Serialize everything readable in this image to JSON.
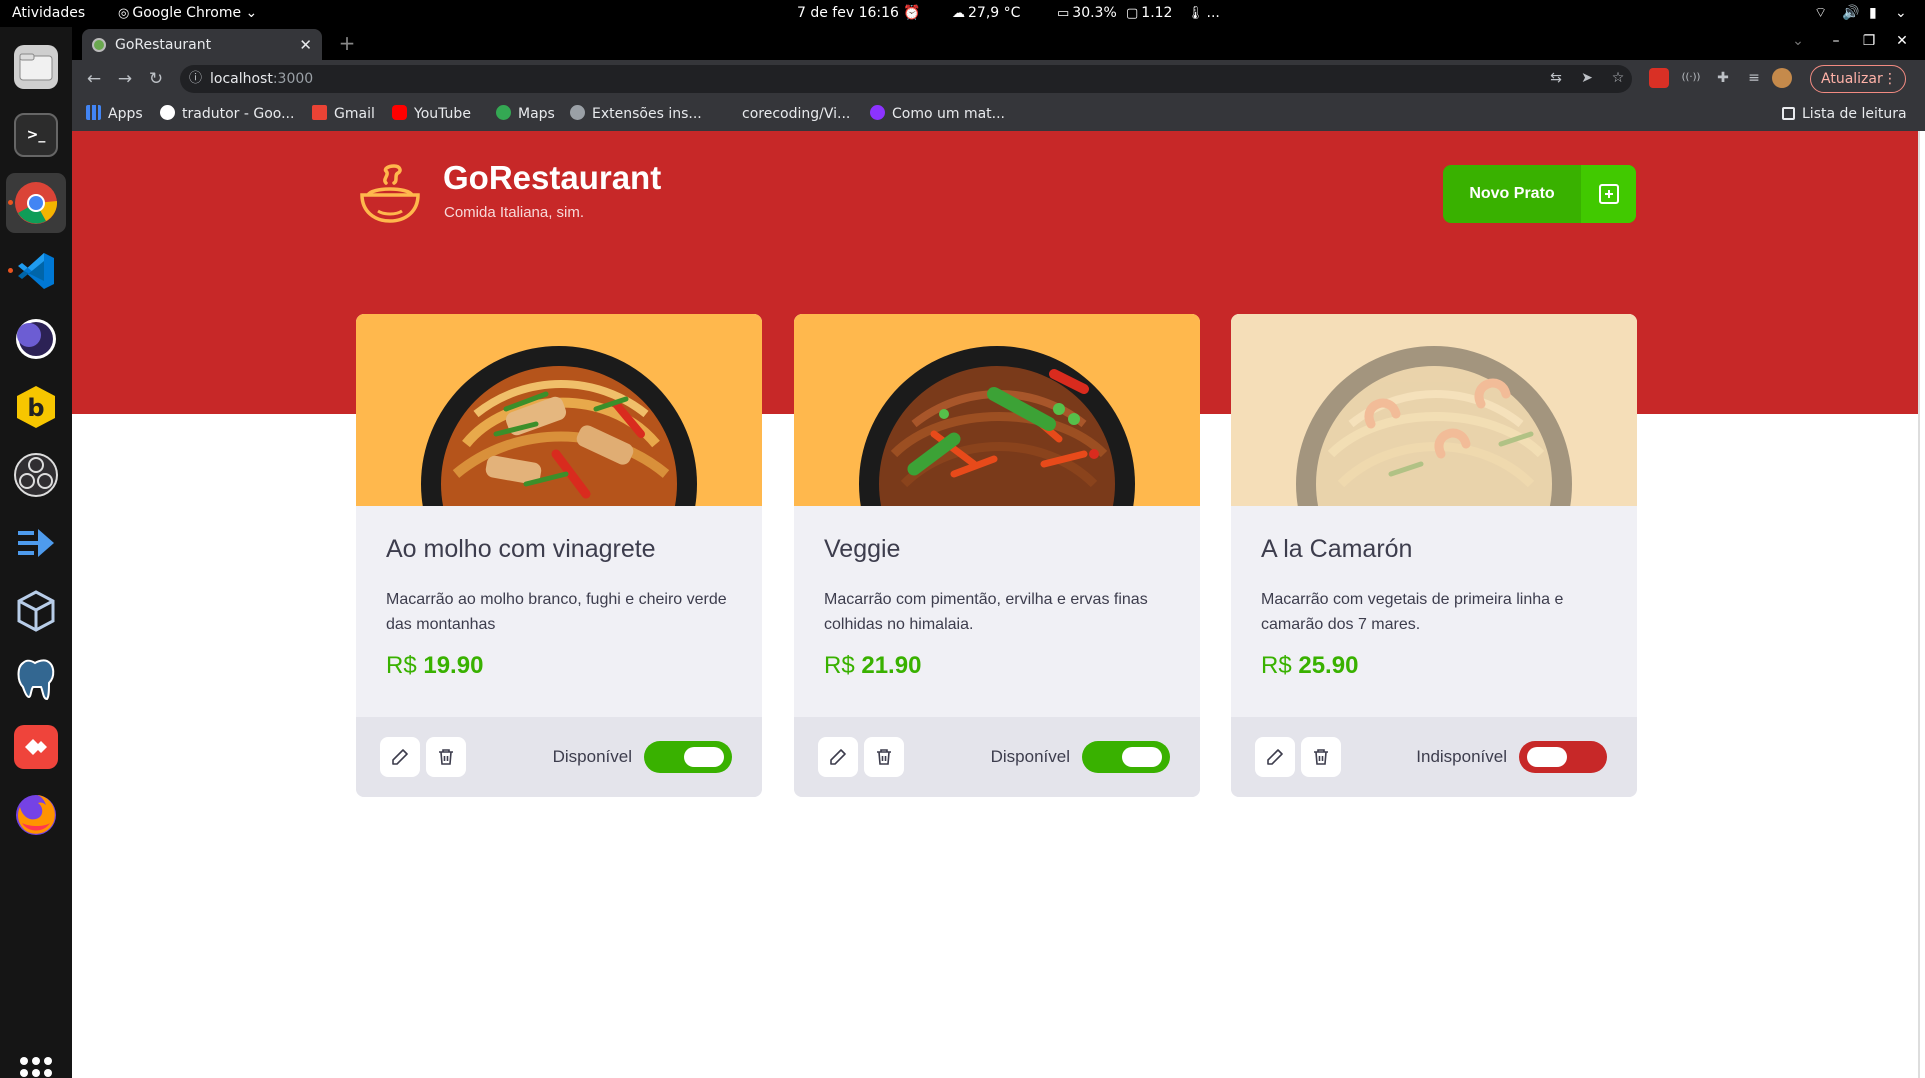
{
  "system_bar": {
    "activities": "Atividades",
    "app_menu": "Google Chrome",
    "date_time": "7 de fev  16:16",
    "weather": "27,9 °C",
    "cpu": "30.3%",
    "load": "1.12",
    "more": "..."
  },
  "dock": {
    "apps": [
      "Files",
      "Terminal",
      "Google Chrome",
      "Visual Studio Code",
      "Eclipse",
      "Bitwarden",
      "OBS Studio",
      "Azure Data Studio",
      "VirtualBox",
      "pgAdmin",
      "AnyDesk",
      "Firefox"
    ],
    "active": "Google Chrome"
  },
  "browser": {
    "tab_title": "GoRestaurant",
    "url_host": "localhost",
    "url_port": ":3000",
    "update_button": "Atualizar",
    "bookmarks": [
      "Apps",
      "tradutor - Goo...",
      "Gmail",
      "YouTube",
      "Maps",
      "Extensões ins...",
      "corecoding/Vi...",
      "Como um mat..."
    ],
    "reading_list": "Lista de leitura"
  },
  "header": {
    "title": "GoRestaurant",
    "subtitle": "Comida Italiana, sim.",
    "new_dish_label": "Novo Prato"
  },
  "dishes": [
    {
      "name": "Ao molho com vinagrete",
      "description": "Macarrão ao molho branco, fughi e cheiro verde das montanhas",
      "currency": "R$",
      "price": "19.90",
      "status": "Disponível",
      "available": true
    },
    {
      "name": "Veggie",
      "description": "Macarrão com pimentão, ervilha e ervas finas colhidas no himalaia.",
      "currency": "R$",
      "price": "21.90",
      "status": "Disponível",
      "available": true
    },
    {
      "name": "A la Camarón",
      "description": "Macarrão com vegetais de primeira linha e camarão dos 7 mares.",
      "currency": "R$",
      "price": "25.90",
      "status": "Indisponível",
      "available": false
    }
  ],
  "colors": {
    "hero_red": "#c72828",
    "green": "#39b100",
    "card_image_bg": "#ffb84d"
  }
}
